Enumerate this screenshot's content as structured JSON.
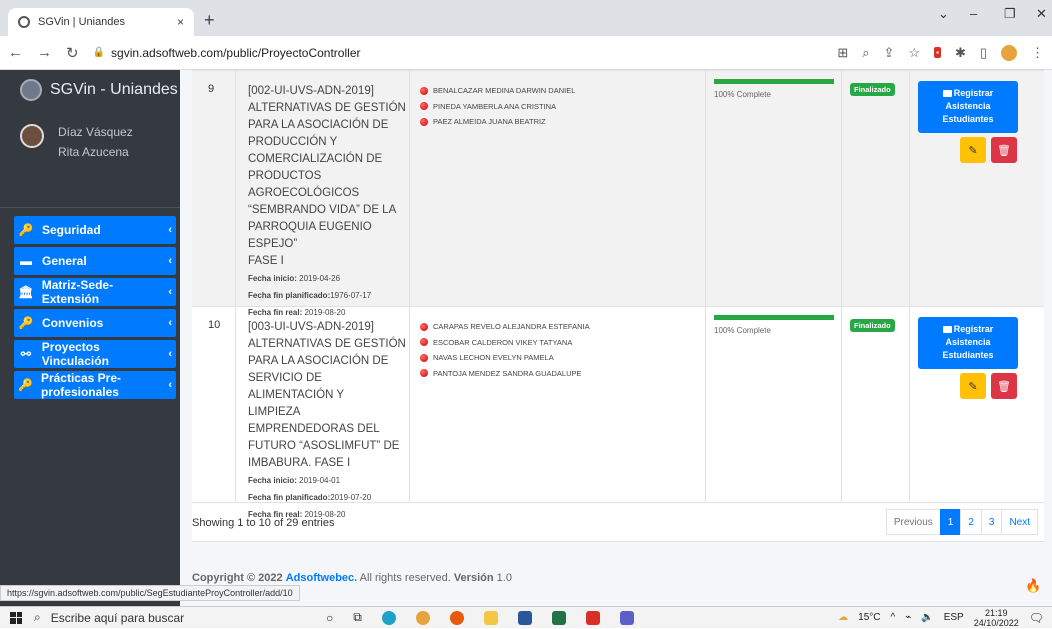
{
  "browser": {
    "tab_title": "SGVin | Uniandes",
    "tab_close": "×",
    "new_tab": "+",
    "url": "sgvin.adsoftweb.com/public/ProyectoController",
    "status_url": "https://sgvin.adsoftweb.com/public/SegEstudianteProyController/add/10"
  },
  "sidebar": {
    "brand": "SGVin - Uniandes",
    "user_line1": "Díaz Vásquez",
    "user_line2": "Rita Azucena",
    "items": [
      {
        "label": "Seguridad",
        "icon": "key-icon"
      },
      {
        "label": "General",
        "icon": "folder-icon"
      },
      {
        "label": "Matriz-Sede-Extensión",
        "icon": "bank-icon"
      },
      {
        "label": "Convenios",
        "icon": "key-icon"
      },
      {
        "label": "Proyectos Vinculación",
        "icon": "sitemap-icon"
      },
      {
        "label": "Prácticas Pre-profesionales",
        "icon": "key-icon"
      }
    ]
  },
  "table": {
    "rows": [
      {
        "num": "9",
        "project_lines": [
          "[002-UI-UVS-ADN-2019]",
          "ALTERNATIVAS DE GESTIÓN",
          "PARA LA ASOCIACIÓN DE",
          "PRODUCCIÓN Y",
          "COMERCIALIZACIÓN DE",
          "PRODUCTOS AGROECOLÓGICOS",
          "“SEMBRANDO VIDA” DE LA",
          "PARROQUIA EUGENIO ESPEJO”",
          "FASE I"
        ],
        "start_label": "Fecha inicio:",
        "start": "2019-04-26",
        "planned_label": "Fecha fin planificado:",
        "planned": "1976-07-17",
        "real_label": "Fecha fin real:",
        "real": "2019-08-20",
        "students": [
          "BENALCAZAR MEDINA DARWIN DANIEL",
          "PINEDA YAMBERLA ANA CRISTINA",
          "PAEZ ALMEIDA JUANA BEATRIZ"
        ],
        "progress": 100,
        "progress_text": "100% Complete",
        "status": "Finalizado",
        "action": [
          "Registrar",
          "Asistencia",
          "Estudiantes"
        ]
      },
      {
        "num": "10",
        "project_lines": [
          "[003-UI-UVS-ADN-2019]",
          "ALTERNATIVAS DE GESTIÓN",
          "PARA LA ASOCIACIÓN DE",
          "SERVICIO DE ALIMENTACIÓN Y",
          "LIMPIEZA EMPRENDEDORAS DEL",
          "FUTURO “ASOSLIMFUT” DE",
          "IMBABURA. FASE I"
        ],
        "start_label": "Fecha inicio:",
        "start": "2019-04-01",
        "planned_label": "Fecha fin planificado:",
        "planned": "2019-07-20",
        "real_label": "Fecha fin real:",
        "real": "2019-08-20",
        "students": [
          "CARAPAS REVELO ALEJANDRA ESTEFANIA",
          "ESCOBAR CALDERON VIKEY TATYANA",
          "NAVAS LECHON EVELYN PAMELA",
          "PANTOJA MENDEZ SANDRA GUADALUPE"
        ],
        "progress": 100,
        "progress_text": "100% Complete",
        "status": "Finalizado",
        "action": [
          "Registrar",
          "Asistencia",
          "Estudiantes"
        ]
      }
    ],
    "entries_text": "Showing 1 to 10 of 29 entries",
    "pager": {
      "previous": "Previous",
      "pages": [
        "1",
        "2",
        "3"
      ],
      "next": "Next",
      "active": "1"
    }
  },
  "footer": {
    "prefix": "Copyright © 2022",
    "company": "Adsoftwebec.",
    "rights": "All rights reserved.",
    "version_label": "Versión",
    "version": "1.0"
  },
  "taskbar": {
    "search_placeholder": "Escribe aquí para buscar",
    "weather": "15°C",
    "lang": "ESP",
    "time": "21:19",
    "date": "24/10/2022"
  },
  "colors": {
    "primary": "#007bff",
    "success": "#28a745",
    "warning": "#ffc107",
    "danger": "#dc3545",
    "sidebar": "#343a40"
  }
}
